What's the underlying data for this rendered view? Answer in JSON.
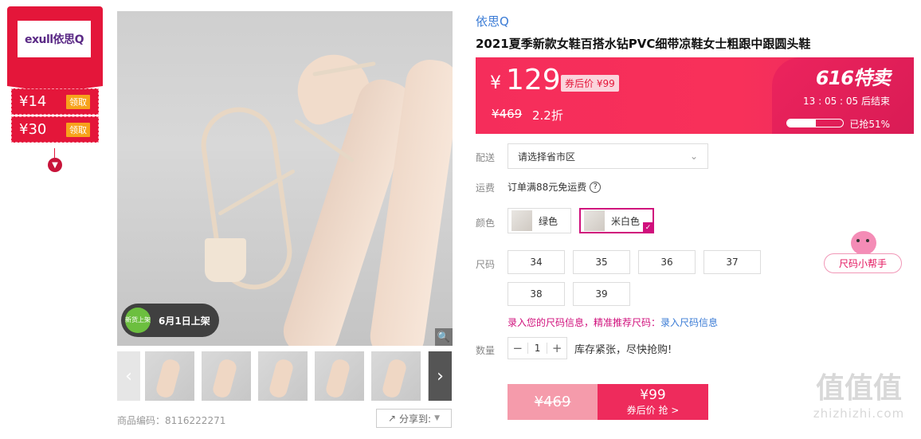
{
  "side": {
    "logo_text": "exull依思Q",
    "coupons": [
      {
        "amount": "¥14",
        "action": "领取"
      },
      {
        "amount": "¥30",
        "action": "领取"
      }
    ],
    "expand_icon": "chevron-down-icon"
  },
  "gallery": {
    "badge_dot": "新货上架",
    "badge_text": "6月1日上架",
    "thumb_count": 6,
    "product_code_label": "商品编码：8116222271",
    "share_label": "分享到:"
  },
  "product": {
    "brand": "依思Q",
    "title": "2021夏季新款女鞋百搭水钻PVC细带凉鞋女士粗跟中跟圆头鞋"
  },
  "price": {
    "currency": "¥",
    "value": "129",
    "after_coupon": "券后价 ¥99",
    "original": "¥469",
    "discount": "2.2折",
    "promo_title": "616特卖",
    "countdown": "13 : 05 : 05  后结束",
    "sold_percent": 51,
    "sold_text": "已抢51%"
  },
  "delivery": {
    "label": "配送",
    "placeholder": "请选择省市区"
  },
  "freight": {
    "label": "运费",
    "text": "订单满88元免运费"
  },
  "colors": {
    "label": "颜色",
    "options": [
      {
        "name": "绿色",
        "selected": false
      },
      {
        "name": "米白色",
        "selected": true
      }
    ]
  },
  "sizes": {
    "label": "尺码",
    "options": [
      "34",
      "35",
      "36",
      "37",
      "38",
      "39"
    ],
    "hint": "录入您的尺码信息，精准推荐尺码：",
    "hint_link": "录入尺码信息"
  },
  "quantity": {
    "label": "数量",
    "value": "1",
    "stock": "库存紧张，尽快抢购!"
  },
  "buy": {
    "original": "¥469",
    "price": "¥99",
    "sub": "券后价 抢 >"
  },
  "helper": {
    "label": "尺码小帮手"
  },
  "watermark": {
    "main": "值值值",
    "site": "zhizhizhi.com"
  },
  "colors_hex": {
    "accent": "#e4163a",
    "price_bg": "#f8305a",
    "link": "#3a7bd5",
    "select_border": "#d0107c"
  }
}
